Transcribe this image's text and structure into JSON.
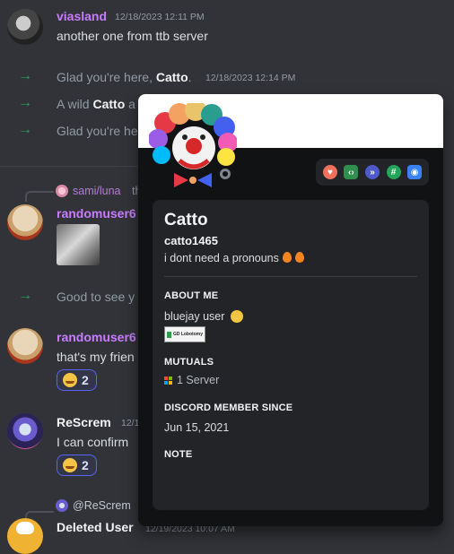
{
  "messages": {
    "m1": {
      "author": "viasland",
      "timestamp": "12/18/2023 12:11 PM",
      "text": "another one from ttb server"
    },
    "sys1": {
      "pre": "Glad you're here, ",
      "user": "Catto",
      "post": ".",
      "timestamp": "12/18/2023 12:14 PM"
    },
    "sys2": {
      "pre": "A wild ",
      "user": "Catto",
      "post": " a"
    },
    "sys3": {
      "pre": "Glad you're he"
    },
    "reply1": {
      "replied_user": "sami/luna",
      "replied_tail": "th"
    },
    "m2": {
      "author": "randomuser6"
    },
    "sys4": {
      "pre": "Good to see y"
    },
    "m3": {
      "author": "randomuser6",
      "text": "that's my frien",
      "reaction_count": "2"
    },
    "m4": {
      "author": "ReScrem",
      "timestamp": "12/1",
      "text": "I can confirm",
      "reaction_count": "2"
    },
    "reply2": {
      "replied_user": "@ReScrem"
    },
    "m5": {
      "author": "Deleted User",
      "timestamp": "12/19/2023 10:07 AM"
    }
  },
  "profile": {
    "display_name": "Catto",
    "username": "catto1465",
    "pronouns": "i dont need a pronouns",
    "about_header": "ABOUT ME",
    "about_text": "bluejay user",
    "about_image_text": "GD Lobotomy",
    "mutuals_header": "MUTUALS",
    "mutuals_text": "1 Server",
    "member_since_header": "DISCORD MEMBER SINCE",
    "member_since": "Jun 15, 2021",
    "note_header": "NOTE"
  },
  "colors": {
    "background": "#313338",
    "accent_purple": "#c77dff",
    "join_arrow": "#23a55a",
    "popout_bg": "#111214",
    "card_bg": "#232428"
  }
}
